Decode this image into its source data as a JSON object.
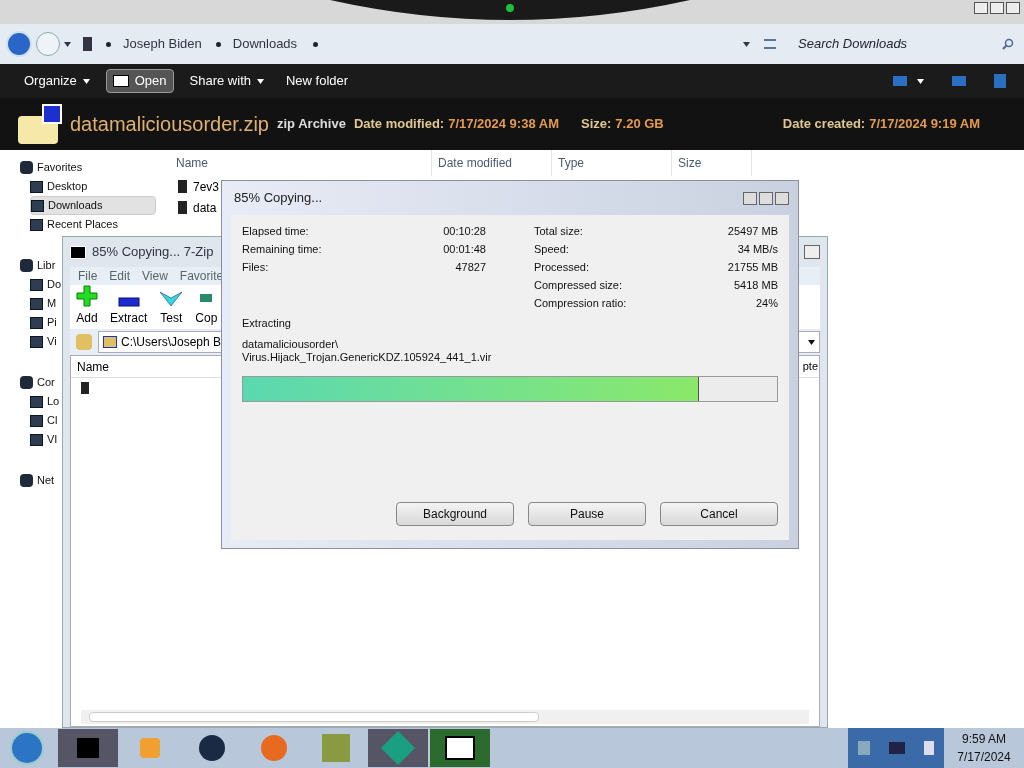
{
  "explorer": {
    "breadcrumb": [
      "Joseph Biden",
      "Downloads"
    ],
    "search": {
      "placeholder": "Search Downloads"
    },
    "toolbar": [
      "Organize",
      "Open",
      "Share with",
      "New folder"
    ],
    "details": {
      "filename": "datamaliciousorder.zip",
      "type": "zip Archive",
      "fields": [
        {
          "label": "Date modified:",
          "value": "7/17/2024 9:38 AM"
        },
        {
          "label": "Size:",
          "value": "7.20 GB"
        },
        {
          "label": "Date created:",
          "value": "7/17/2024 9:19 AM"
        }
      ]
    },
    "nav": [
      {
        "label": "Favorites",
        "kind": "header",
        "selected": false
      },
      {
        "label": "Desktop",
        "kind": "item",
        "selected": false
      },
      {
        "label": "Downloads",
        "kind": "item",
        "selected": true
      },
      {
        "label": "Recent Places",
        "kind": "item",
        "selected": false
      },
      {
        "label": "Libr",
        "kind": "header",
        "selected": false
      },
      {
        "label": "Do",
        "kind": "item",
        "selected": false
      },
      {
        "label": "M",
        "kind": "item",
        "selected": false
      },
      {
        "label": "Pi",
        "kind": "item",
        "selected": false
      },
      {
        "label": "Vi",
        "kind": "item",
        "selected": false
      },
      {
        "label": "Cor",
        "kind": "header",
        "selected": false
      },
      {
        "label": "Lo",
        "kind": "item",
        "selected": false
      },
      {
        "label": "Cl",
        "kind": "item",
        "selected": false
      },
      {
        "label": "VI",
        "kind": "item",
        "selected": false
      },
      {
        "label": "Net",
        "kind": "header",
        "selected": false
      }
    ],
    "columns": [
      "Name",
      "Date modified",
      "Type",
      "Size"
    ],
    "files": [
      "7ev3",
      "data"
    ]
  },
  "sevenzip": {
    "title": "85% Copying... 7-Zip",
    "menu": [
      "File",
      "Edit",
      "View",
      "Favorite"
    ],
    "tools": [
      {
        "label": "Add",
        "kind": "add"
      },
      {
        "label": "Extract",
        "kind": "extract"
      },
      {
        "label": "Test",
        "kind": "test"
      },
      {
        "label": "Cop",
        "kind": "copy"
      }
    ],
    "path": "C:\\Users\\Joseph B",
    "columns": [
      "Name",
      "pte"
    ]
  },
  "dialog": {
    "title": "85% Copying...",
    "left_stats": [
      {
        "label": "Elapsed time:",
        "value": "00:10:28"
      },
      {
        "label": "Remaining time:",
        "value": "00:01:48"
      },
      {
        "label": "Files:",
        "value": "47827"
      }
    ],
    "right_stats": [
      {
        "label": "Total size:",
        "value": "25497 MB"
      },
      {
        "label": "Speed:",
        "value": "34 MB/s"
      },
      {
        "label": "Processed:",
        "value": "21755 MB"
      },
      {
        "label": "Compressed size:",
        "value": "5418 MB"
      },
      {
        "label": "Compression ratio:",
        "value": "24%"
      }
    ],
    "action": "Extracting",
    "current_file": [
      "datamaliciousorder\\",
      "Virus.Hijack_Trojan.GenericKDZ.105924_441_1.vir"
    ],
    "level": 0.853,
    "buttons": [
      "Background",
      "Pause",
      "Cancel"
    ]
  },
  "taskbar": {
    "time": "9:59 AM",
    "date": "7/17/2024"
  }
}
